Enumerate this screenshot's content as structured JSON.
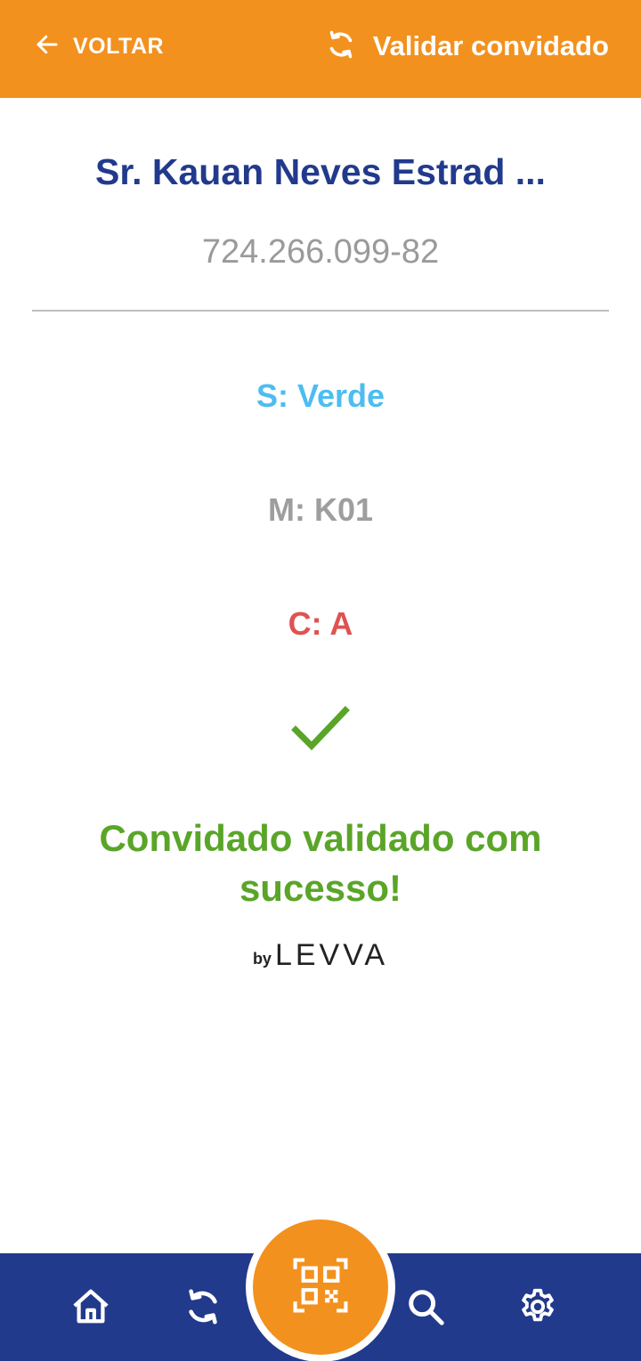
{
  "header": {
    "back_label": "VOLTAR",
    "validate_label": "Validar convidado",
    "background_color": "#f2911e"
  },
  "guest": {
    "name": "Sr. Kauan Neves Estrad ...",
    "document": "724.266.099-82"
  },
  "details": {
    "s_line": "S: Verde",
    "m_line": "M: K01",
    "c_line": "C: A"
  },
  "status": {
    "icon": "checkmark-icon",
    "message": "Convidado validado com sucesso!",
    "color": "#5aa528"
  },
  "branding": {
    "by": "by",
    "name": "LEVVA"
  },
  "bottom_nav": {
    "background_color": "#223a8c",
    "items": [
      {
        "icon": "home-icon"
      },
      {
        "icon": "sync-icon"
      },
      {
        "icon": "qr-code-icon"
      },
      {
        "icon": "search-icon"
      },
      {
        "icon": "gear-icon"
      }
    ]
  }
}
